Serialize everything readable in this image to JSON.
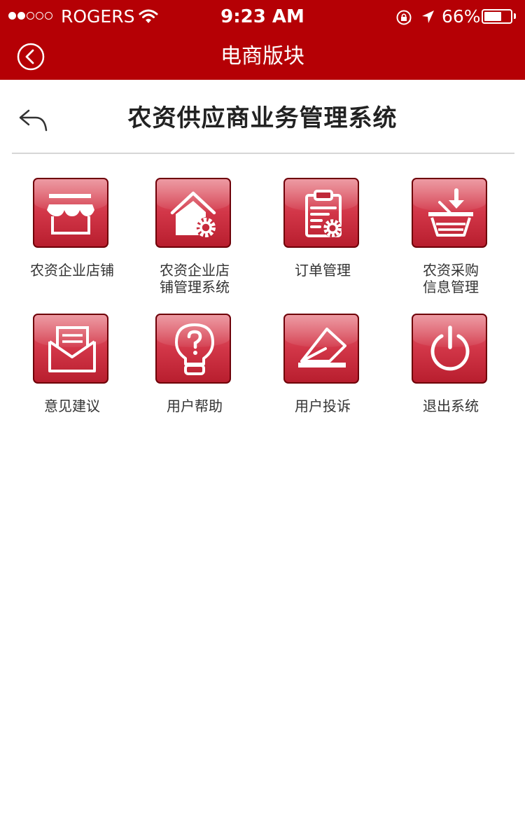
{
  "status_bar": {
    "signal_filled": 2,
    "signal_total": 5,
    "carrier": "ROGERS",
    "time": "9:23 AM",
    "battery_percent_text": "66%",
    "battery_level": 0.66,
    "icons": [
      "wifi-icon",
      "rotation-lock-icon",
      "location-arrow-icon",
      "battery-icon"
    ]
  },
  "nav_bar": {
    "title": "电商版块",
    "back_icon": "circle-chevron-left-icon"
  },
  "header": {
    "title": "农资供应商业务管理系统",
    "back_icon": "reply-arrow-icon"
  },
  "menu": {
    "items": [
      {
        "line1": "农资企业店铺",
        "line2": "",
        "icon": "storefront-icon"
      },
      {
        "line1": "农资企业店",
        "line2": "铺管理系统",
        "icon": "house-gear-icon"
      },
      {
        "line1": "订单管理",
        "line2": "",
        "icon": "clipboard-gear-icon"
      },
      {
        "line1": "农资采购",
        "line2": "信息管理",
        "icon": "basket-download-icon"
      },
      {
        "line1": "意见建议",
        "line2": "",
        "icon": "open-envelope-icon"
      },
      {
        "line1": "用户帮助",
        "line2": "",
        "icon": "lightbulb-question-icon"
      },
      {
        "line1": "用户投诉",
        "line2": "",
        "icon": "eraser-icon"
      },
      {
        "line1": "退出系统",
        "line2": "",
        "icon": "power-icon"
      }
    ]
  },
  "colors": {
    "bar_red": "#b50005",
    "tile_red": "#d23648",
    "tile_border": "#6e0008",
    "title_text": "#222222",
    "label_text": "#333333"
  }
}
